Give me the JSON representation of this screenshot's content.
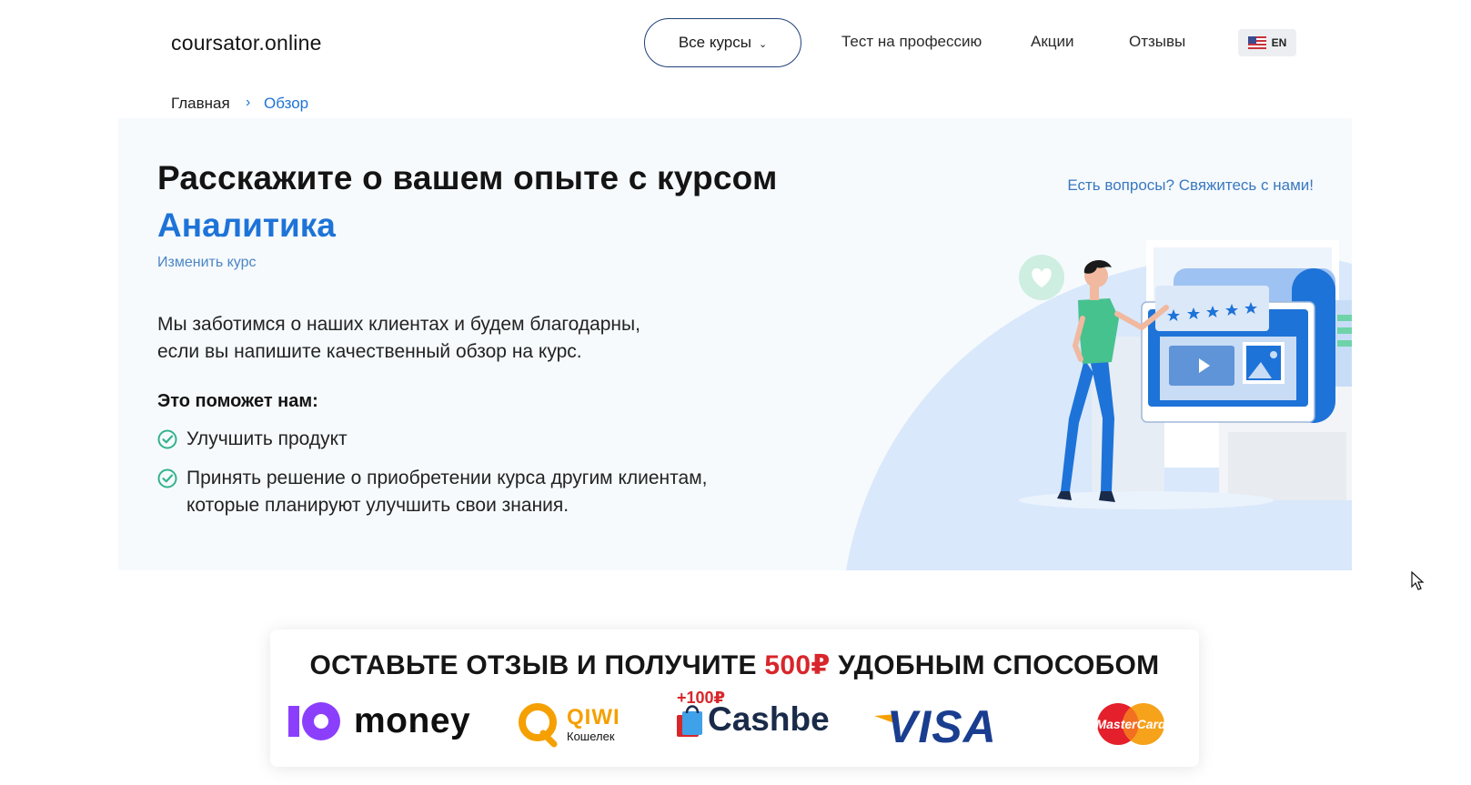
{
  "header": {
    "logo": "coursator.online",
    "all_courses": "Все курсы",
    "nav": [
      "Тест на профессию",
      "Акции",
      "Отзывы"
    ],
    "lang": "EN"
  },
  "breadcrumb": {
    "home": "Главная",
    "separator": "›",
    "current": "Обзор"
  },
  "hero": {
    "title": "Расскажите о вашем опыте с курсом",
    "course": "Аналитика",
    "change_course": "Изменить курс",
    "contact": "Есть вопросы? Свяжитесь с нами!",
    "intro_line1": "Мы заботимся о наших клиентах и будем благодарны,",
    "intro_line2": "если вы напишите качественный обзор на курс.",
    "helps_title": "Это поможет нам:",
    "bullets": [
      {
        "line1": "Улучшить продукт",
        "line2": ""
      },
      {
        "line1": "Принять решение о приобретении курса другим клиентам,",
        "line2": "которые планируют улучшить свои знания."
      }
    ]
  },
  "reward": {
    "title_before": "ОСТАВЬТЕ ОТЗЫВ И ПОЛУЧИТЕ ",
    "amount": "500₽",
    "title_after": " УДОБНЫМ СПОСОБОМ",
    "methods": {
      "yoomoney_mark": "Ю",
      "yoomoney": "money",
      "qiwi": "QIWI",
      "qiwi_sub": "Кошелек",
      "cashbe_bonus": "+100₽",
      "cashbe": "Cashbe",
      "visa": "VISA",
      "mastercard": "MasterCard"
    }
  },
  "colors": {
    "accent": "#1e73d8",
    "hero_bg": "#f6fafd",
    "check": "#34b38a",
    "price_red": "#d8262b",
    "yoomoney_purple": "#8b3ffd",
    "qiwi_orange": "#f5a000",
    "visa_blue": "#1a3d8f"
  }
}
